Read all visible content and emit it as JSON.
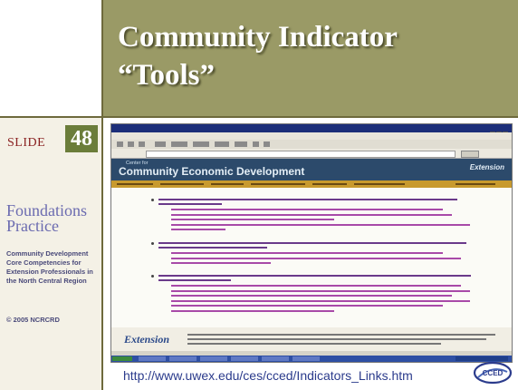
{
  "slide": {
    "title_line1": "Community Indicator",
    "title_line2": "“Tools”",
    "slide_label": "SLIDE",
    "slide_number": "48",
    "logo_line1": "Foundations",
    "logo_line2": "Practice",
    "org_text": "Community Development Core Competencies for Extension Professionals in the North Central Region",
    "copyright": "© 2005 NCRCRD",
    "url": "http://www.uwex.edu/ces/cced/Indicators_Links.htm",
    "bottom_logo": "CCED"
  },
  "browser": {
    "banner_subtitle": "Center for",
    "banner_title": "Community Economic Development",
    "banner_ext": "Extension",
    "footer_logo": "Extension"
  },
  "colors": {
    "title_band": "#9a9a66",
    "slide_number_bg": "#6b7d3a",
    "url_text": "#2b3b8c",
    "banner": "#2c4a6b",
    "nav_bar": "#c89a2e"
  }
}
